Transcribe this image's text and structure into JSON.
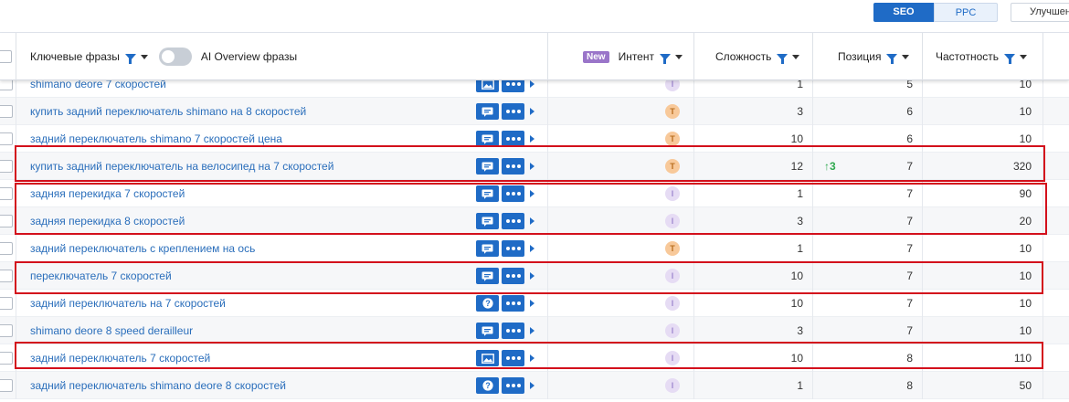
{
  "toolbar": {
    "seo_label": "SEO",
    "ppc_label": "PPC",
    "improve_label": "Улучшен"
  },
  "header": {
    "keywords_label": "Ключевые фразы",
    "ai_overview_label": "AI Overview фразы",
    "new_badge": "New",
    "intent_label": "Интент",
    "difficulty_label": "Сложность",
    "position_label": "Позиция",
    "frequency_label": "Частотность"
  },
  "colors": {
    "accent": "#1f6bc6",
    "link": "#2a6ebb",
    "highlight": "#d3101c",
    "trend_up": "#2fa84f"
  },
  "rows": [
    {
      "keyword": "shimano deore 7 скоростей",
      "icon": "image-icon",
      "intent": "I",
      "difficulty": "1",
      "change": "",
      "position": "5",
      "frequency": "10"
    },
    {
      "keyword": "купить задний переключатель shimano на 8 скоростей",
      "icon": "chat-icon",
      "intent": "T",
      "difficulty": "3",
      "change": "",
      "position": "6",
      "frequency": "10"
    },
    {
      "keyword": "задний переключатель shimano 7 скоростей цена",
      "icon": "chat-icon",
      "intent": "T",
      "difficulty": "10",
      "change": "",
      "position": "6",
      "frequency": "10"
    },
    {
      "keyword": "купить задний переключатель на велосипед на 7 скоростей",
      "icon": "chat-icon",
      "intent": "T",
      "difficulty": "12",
      "change": "↑3",
      "position": "7",
      "frequency": "320"
    },
    {
      "keyword": "задняя перекидка 7 скоростей",
      "icon": "chat-icon",
      "intent": "I",
      "difficulty": "1",
      "change": "",
      "position": "7",
      "frequency": "90"
    },
    {
      "keyword": "задняя перекидка 8 скоростей",
      "icon": "chat-icon",
      "intent": "I",
      "difficulty": "3",
      "change": "",
      "position": "7",
      "frequency": "20"
    },
    {
      "keyword": "задний переключатель с креплением на ось",
      "icon": "chat-icon",
      "intent": "T",
      "difficulty": "1",
      "change": "",
      "position": "7",
      "frequency": "10"
    },
    {
      "keyword": "переключатель 7 скоростей",
      "icon": "chat-icon",
      "intent": "I",
      "difficulty": "10",
      "change": "",
      "position": "7",
      "frequency": "10"
    },
    {
      "keyword": "задний переключатель на 7 скоростей",
      "icon": "question-icon",
      "intent": "I",
      "difficulty": "10",
      "change": "",
      "position": "7",
      "frequency": "10"
    },
    {
      "keyword": "shimano deore 8 speed derailleur",
      "icon": "chat-icon",
      "intent": "I",
      "difficulty": "3",
      "change": "",
      "position": "7",
      "frequency": "10"
    },
    {
      "keyword": "задний переключатель 7 скоростей",
      "icon": "image-icon",
      "intent": "I",
      "difficulty": "10",
      "change": "",
      "position": "8",
      "frequency": "110"
    },
    {
      "keyword": "задний переключатель shimano deore 8 скоростей",
      "icon": "question-icon",
      "intent": "I",
      "difficulty": "1",
      "change": "",
      "position": "8",
      "frequency": "50"
    }
  ]
}
